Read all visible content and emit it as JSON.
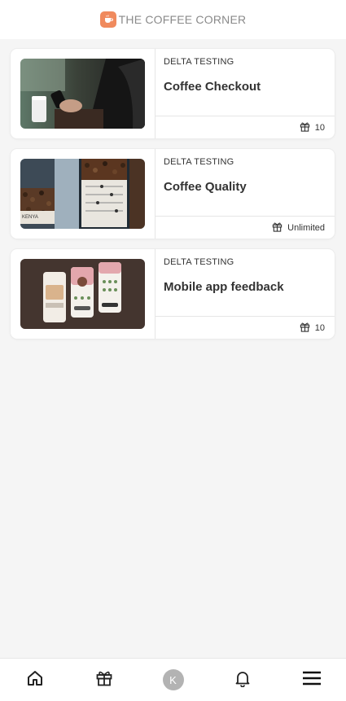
{
  "header": {
    "brand": "THE COFFEE CORNER",
    "logo_icon": "coffee-cup-icon"
  },
  "cards": [
    {
      "tag": "DELTA TESTING",
      "title": "Coffee Checkout",
      "reward": "10",
      "reward_icon": "gift-icon"
    },
    {
      "tag": "DELTA TESTING",
      "title": "Coffee Quality",
      "reward": "Unlimited",
      "reward_icon": "gift-icon"
    },
    {
      "tag": "DELTA TESTING",
      "title": "Mobile app feedback",
      "reward": "10",
      "reward_icon": "gift-icon"
    }
  ],
  "thumb2": {
    "label": "KENYA"
  },
  "nav": {
    "avatar_initial": "K",
    "items": [
      "home-icon",
      "gift-icon",
      "avatar",
      "bell-icon",
      "menu-icon"
    ]
  },
  "colors": {
    "accent": "#f08a5d",
    "background": "#f5f5f5"
  }
}
